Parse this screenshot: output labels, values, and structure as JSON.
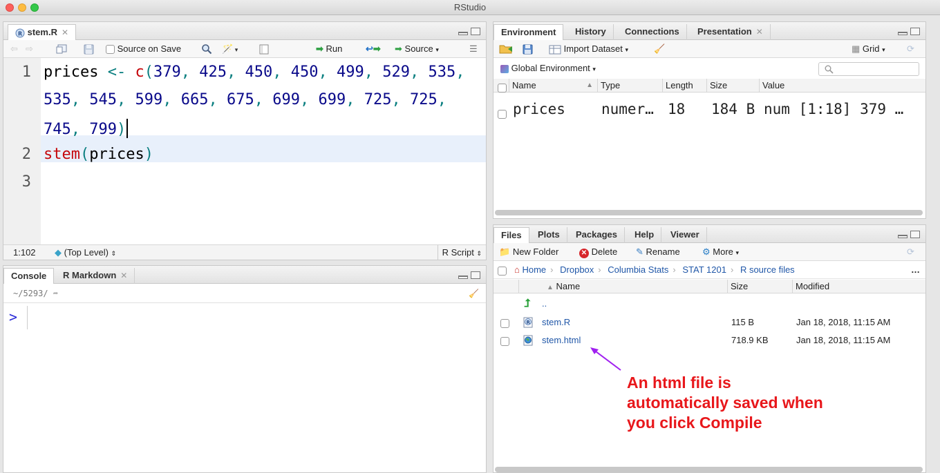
{
  "window": {
    "title": "RStudio"
  },
  "source_pane": {
    "tab_label": "stem.R",
    "toolbar": {
      "source_on_save": "Source on Save",
      "run": "Run",
      "source": "Source"
    },
    "line_numbers": [
      "1",
      "2",
      "3"
    ],
    "code": {
      "l1_var": "prices",
      "l1_assign": "<-",
      "l1_func": "c",
      "nums_a": [
        "379",
        "425",
        "450",
        "450",
        "499",
        "529",
        "535"
      ],
      "nums_b": [
        "535",
        "545",
        "599",
        "665",
        "675",
        "699",
        "699",
        "725",
        "725"
      ],
      "nums_c": [
        "745",
        "799"
      ],
      "l2_func": "stem",
      "l2_arg": "prices"
    },
    "status": {
      "position": "1:102",
      "scope": "(Top Level)",
      "filetype": "R Script"
    }
  },
  "console_pane": {
    "tabs": [
      "Console",
      "R Markdown"
    ],
    "path": "~/5293/",
    "prompt": ">"
  },
  "env_pane": {
    "tabs": [
      "Environment",
      "History",
      "Connections",
      "Presentation"
    ],
    "toolbar": {
      "import": "Import Dataset",
      "view": "Grid"
    },
    "scope": "Global Environment",
    "columns": [
      "Name",
      "Type",
      "Length",
      "Size",
      "Value"
    ],
    "rows": [
      {
        "name": "prices",
        "type": "numer…",
        "length": "18",
        "size": "184 B",
        "value": "num [1:18] 379 …"
      }
    ]
  },
  "files_pane": {
    "tabs": [
      "Files",
      "Plots",
      "Packages",
      "Help",
      "Viewer"
    ],
    "toolbar": {
      "new_folder": "New Folder",
      "delete": "Delete",
      "rename": "Rename",
      "more": "More"
    },
    "breadcrumb": [
      "Home",
      "Dropbox",
      "Columbia Stats",
      "STAT 1201",
      "R source files"
    ],
    "columns": [
      "Name",
      "Size",
      "Modified"
    ],
    "parent": "..",
    "files": [
      {
        "name": "stem.R",
        "size": "115 B",
        "modified": "Jan 18, 2018, 11:15 AM"
      },
      {
        "name": "stem.html",
        "size": "718.9 KB",
        "modified": "Jan 18, 2018, 11:15 AM"
      }
    ]
  },
  "annotation": {
    "lines": [
      "An html file is",
      "automatically saved when",
      "you click Compile"
    ],
    "color": "#e8171b",
    "arrow_color": "#a020f0"
  }
}
